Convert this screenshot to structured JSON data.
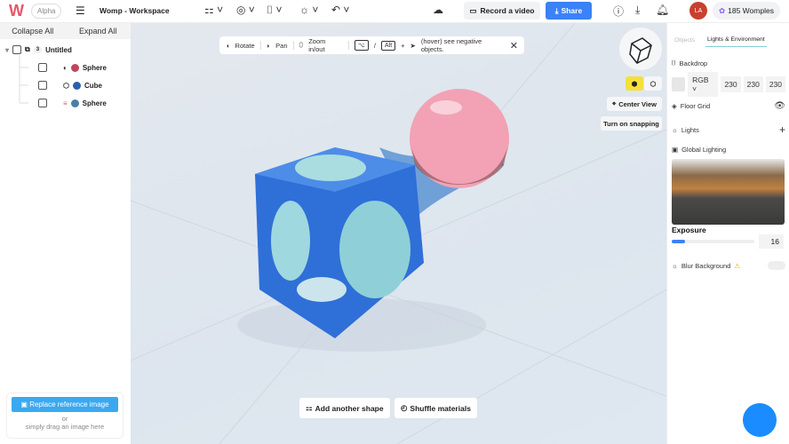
{
  "header": {
    "logo": "W",
    "badge": "Alpha",
    "title": "Womp - Workspace",
    "record": "Record a video",
    "share": "Share",
    "avatar": "LA",
    "womples": "185 Womples"
  },
  "tree": {
    "collapse": "Collapse All",
    "expand": "Expand All",
    "group_count": "3",
    "group_name": "Untitled",
    "items": [
      {
        "name": "Sphere",
        "color": "#c0475a"
      },
      {
        "name": "Cube",
        "color": "#2a5fb0"
      },
      {
        "name": "Sphere",
        "color": "#4a7fa8"
      }
    ]
  },
  "reference": {
    "button": "Replace reference image",
    "or": "or",
    "hint": "simply drag an image here"
  },
  "viewport": {
    "rotate": "Rotate",
    "pan": "Pan",
    "zoom": "Zoom in/out",
    "key1": "⌥",
    "slash": "/",
    "key2": "Alt",
    "plus": "+",
    "negative": "(hover) see negative objects.",
    "center_view": "Center View",
    "snapping": "Turn on snapping",
    "add_shape": "Add another shape",
    "shuffle": "Shuffle materials"
  },
  "panel": {
    "tab_objects": "Objects",
    "tab_lights": "Lights & Environment",
    "backdrop": "Backdrop",
    "color_mode": "RGB",
    "r": "230",
    "g": "230",
    "b": "230",
    "floor_grid": "Floor Grid",
    "lights": "Lights",
    "global_lighting": "Global Lighting",
    "exposure": "Exposure",
    "exposure_value": "16",
    "exposure_fraction": 0.16,
    "blur": "Blur Background"
  },
  "colors": {
    "accent": "#3b82f6",
    "cube": "#2f6fd8",
    "sphere": "#f0a0b0"
  }
}
